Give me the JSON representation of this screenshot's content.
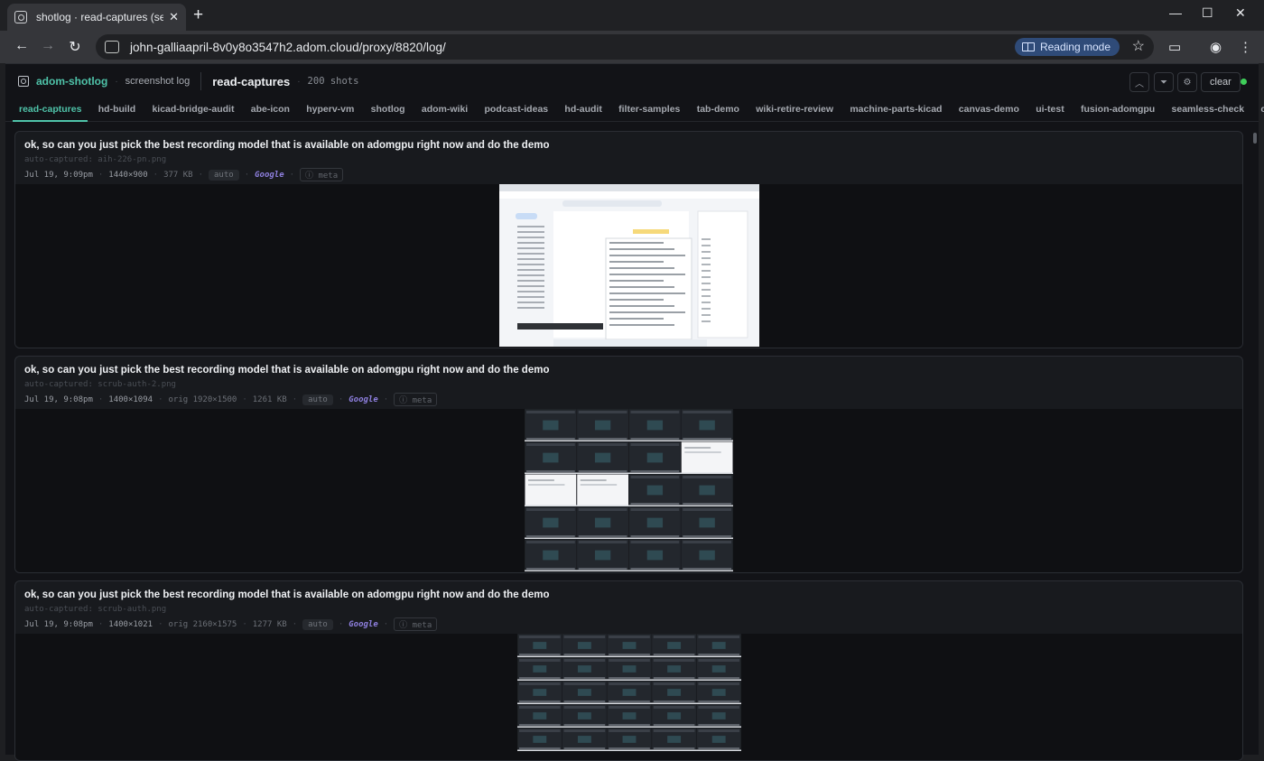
{
  "browser": {
    "tab_title": "shotlog · read-captures (session",
    "url": "john-galliaapril-8v0y8o3547h2.adom.cloud/proxy/8820/log/",
    "reading_mode": "Reading mode"
  },
  "header": {
    "brand": "adom-shotlog",
    "subtitle": "screenshot log",
    "current_tab": "read-captures",
    "shot_count": "200 shots",
    "clear_label": "clear"
  },
  "tabs": [
    "read-captures",
    "hd-build",
    "kicad-bridge-audit",
    "abe-icon",
    "hyperv-vm",
    "shotlog",
    "adom-wiki",
    "podcast-ideas",
    "hd-audit",
    "filter-samples",
    "tab-demo",
    "wiki-retire-review",
    "machine-parts-kicad",
    "canvas-demo",
    "ui-test",
    "fusion-adomgpu",
    "seamless-check",
    "chase-connect"
  ],
  "cards": [
    {
      "title": "ok, so can you just pick the best recording model that is available on adomgpu right now and do the demo",
      "file": "auto-captured: aih-226-pn.png",
      "time": "Jul 19, 9:09pm",
      "dims": "1440×900",
      "orig": "",
      "size": "377 KB",
      "badge": "auto",
      "source": "Google",
      "meta_label": "meta"
    },
    {
      "title": "ok, so can you just pick the best recording model that is available on adomgpu right now and do the demo",
      "file": "auto-captured: scrub-auth-2.png",
      "time": "Jul 19, 9:08pm",
      "dims": "1400×1094",
      "orig": "orig 1920×1500",
      "size": "1261 KB",
      "badge": "auto",
      "source": "Google",
      "meta_label": "meta"
    },
    {
      "title": "ok, so can you just pick the best recording model that is available on adomgpu right now and do the demo",
      "file": "auto-captured: scrub-auth.png",
      "time": "Jul 19, 9:08pm",
      "dims": "1400×1021",
      "orig": "orig 2160×1575",
      "size": "1277 KB",
      "badge": "auto",
      "source": "Google",
      "meta_label": "meta"
    }
  ],
  "colors": {
    "accent": "#4fc3a9",
    "source": "#8f80e0",
    "status": "#3fcf5a"
  }
}
